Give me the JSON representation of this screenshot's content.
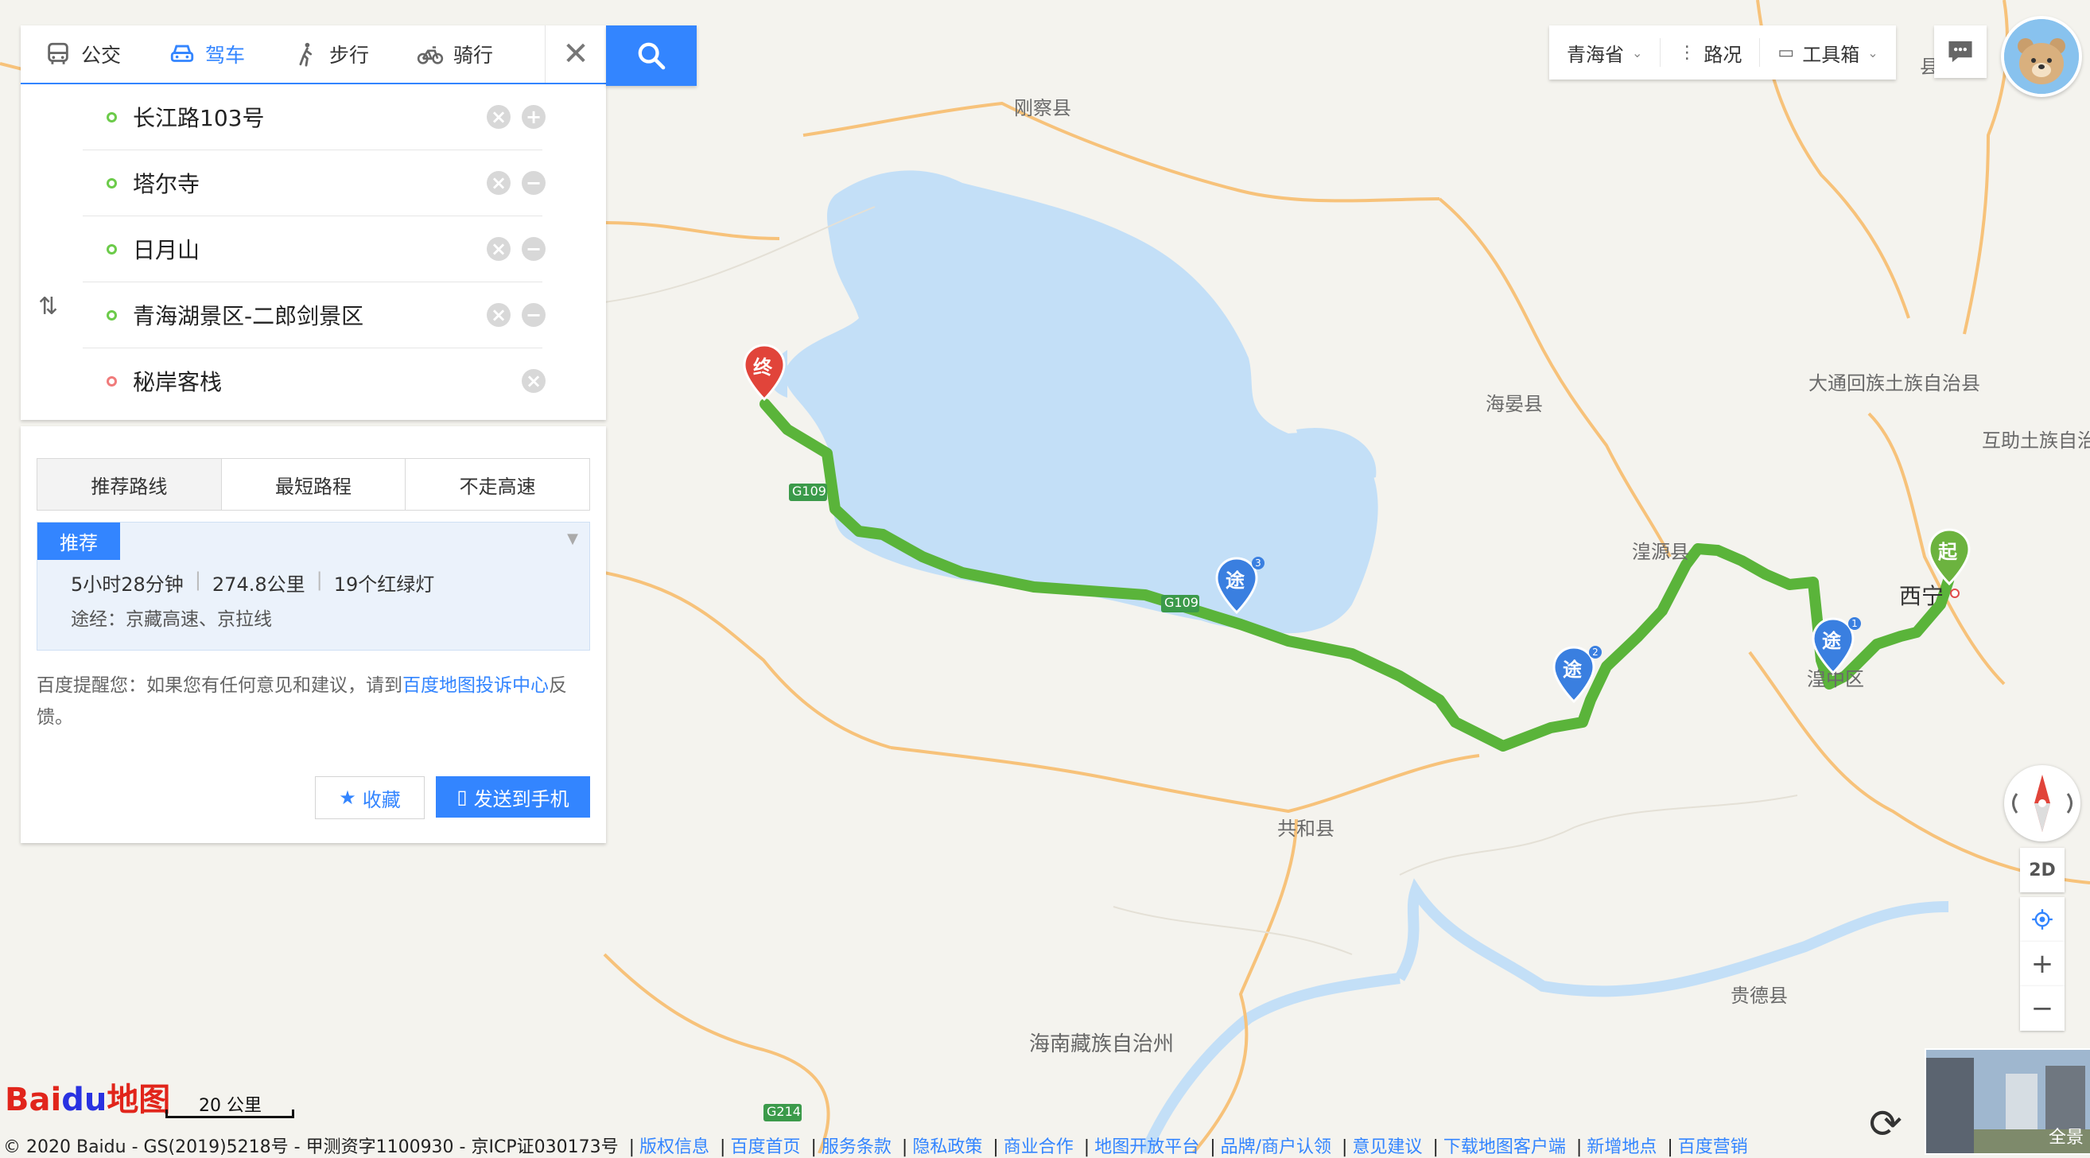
{
  "modes": [
    {
      "label": "公交",
      "icon": "bus-icon",
      "active": false
    },
    {
      "label": "驾车",
      "icon": "car-icon",
      "active": true
    },
    {
      "label": "步行",
      "icon": "walk-icon",
      "active": false
    },
    {
      "label": "骑行",
      "icon": "bike-icon",
      "active": false
    }
  ],
  "waypoints": [
    {
      "text": "长江路103号",
      "role": "start"
    },
    {
      "text": "塔尔寺",
      "role": "via"
    },
    {
      "text": "日月山",
      "role": "via"
    },
    {
      "text": "青海湖景区-二郎剑景区",
      "role": "via"
    },
    {
      "text": "秘岸客栈",
      "role": "end"
    }
  ],
  "policies": [
    "推荐路线",
    "最短路程",
    "不走高速"
  ],
  "recommend": {
    "badge": "推荐",
    "duration": "5小时28分钟",
    "distance": "274.8公里",
    "lights": "19个红绿灯",
    "via": "途经：京藏高速、京拉线"
  },
  "tip": {
    "prefix": "百度提醒您：如果您有任何意见和建议，请到",
    "link": "百度地图投诉中心",
    "suffix": "反馈。"
  },
  "buttons": {
    "favorite": "收藏",
    "send": "发送到手机"
  },
  "toolbar": {
    "province": "青海省",
    "traffic": "路况",
    "tools": "工具箱"
  },
  "map": {
    "labels": {
      "gangcha": "刚察县",
      "haiyan": "海晏县",
      "datong": "大通回族土族自治县",
      "huzhu": "互助土族自治",
      "huangyuan": "湟源县",
      "xining": "西宁",
      "huangzhong": "湟中区",
      "gonghe": "共和县",
      "guide": "贵德县",
      "hainan": "海南藏族自治州",
      "ji": "县"
    },
    "roads": {
      "g109_a": "G109",
      "g109_b": "G109",
      "g214": "G214"
    },
    "markers": {
      "start": "起",
      "end": "终",
      "via": "途",
      "via1": "1",
      "via2": "2",
      "via3": "3"
    },
    "route_color": "#5ab43a",
    "lake_color": "#c3dff7"
  },
  "controls": {
    "mode2d": "2D",
    "zoom_in": "+",
    "zoom_out": "−",
    "pano": "全景"
  },
  "bottom": {
    "scale": "20 公里",
    "logo_a": "Bai",
    "logo_b": "du",
    "logo_c": "地图",
    "copyright": "© 2020 Baidu - GS(2019)5218号 - 甲测资字1100930 - 京ICP证030173号",
    "links": [
      "版权信息",
      "百度首页",
      "服务条款",
      "隐私政策",
      "商业合作",
      "地图开放平台",
      "品牌/商户认领",
      "意见建议",
      "下载地图客户端",
      "新增地点",
      "百度营销"
    ]
  }
}
